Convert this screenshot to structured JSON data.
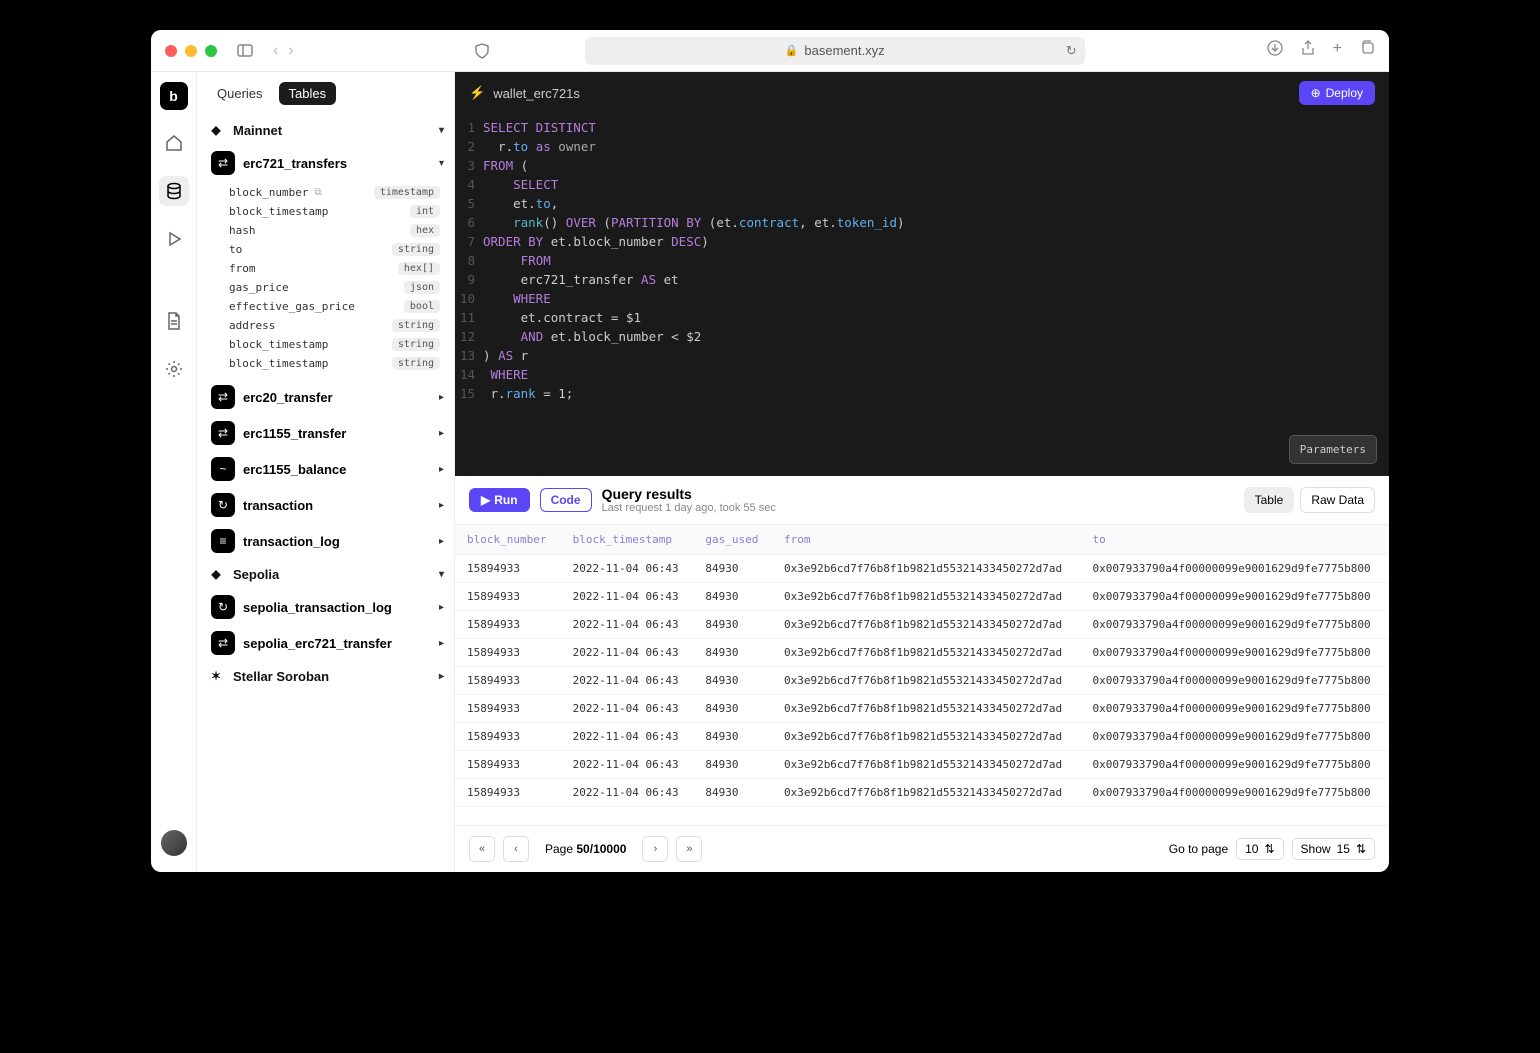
{
  "browser": {
    "url": "basement.xyz"
  },
  "sidebar": {
    "tabs": [
      "Queries",
      "Tables"
    ],
    "active_tab": 1,
    "networks": [
      {
        "name": "Mainnet",
        "icon": "◆",
        "expanded": true,
        "tables": [
          {
            "name": "erc721_transfers",
            "icon": "⇄",
            "expanded": true,
            "columns": [
              {
                "name": "block_number",
                "type": "timestamp"
              },
              {
                "name": "block_timestamp",
                "type": "int"
              },
              {
                "name": "hash",
                "type": "hex"
              },
              {
                "name": "to",
                "type": "string"
              },
              {
                "name": "from",
                "type": "hex[]"
              },
              {
                "name": "gas_price",
                "type": "json"
              },
              {
                "name": "effective_gas_price",
                "type": "bool"
              },
              {
                "name": "address",
                "type": "string"
              },
              {
                "name": "block_timestamp",
                "type": "string"
              },
              {
                "name": "block_timestamp",
                "type": "string"
              }
            ]
          },
          {
            "name": "erc20_transfer",
            "icon": "⇄"
          },
          {
            "name": "erc1155_transfer",
            "icon": "⇄"
          },
          {
            "name": "erc1155_balance",
            "icon": "~"
          },
          {
            "name": "transaction",
            "icon": "↻"
          },
          {
            "name": "transaction_log",
            "icon": "≡"
          }
        ]
      },
      {
        "name": "Sepolia",
        "icon": "◆",
        "expanded": true,
        "tables": [
          {
            "name": "sepolia_transaction_log",
            "icon": "↻"
          },
          {
            "name": "sepolia_erc721_transfer",
            "icon": "⇄"
          }
        ]
      },
      {
        "name": "Stellar Soroban",
        "icon": "✶",
        "expanded": false,
        "tables": []
      }
    ]
  },
  "workspace": {
    "title": "wallet_erc721s",
    "deploy_label": "Deploy",
    "parameters_label": "Parameters",
    "sql_lines": [
      [
        [
          "kw",
          "SELECT DISTINCT"
        ]
      ],
      [
        [
          "op",
          "  r."
        ],
        [
          "id",
          "to"
        ],
        [
          "op",
          " "
        ],
        [
          "kw",
          "as"
        ],
        [
          "op",
          " "
        ],
        [
          "str",
          "owner"
        ]
      ],
      [
        [
          "kw",
          "FROM"
        ],
        [
          "op",
          " ("
        ]
      ],
      [
        [
          "op",
          "    "
        ],
        [
          "kw",
          "SELECT"
        ]
      ],
      [
        [
          "op",
          "    et."
        ],
        [
          "id",
          "to"
        ],
        [
          "op",
          ","
        ]
      ],
      [
        [
          "op",
          "    "
        ],
        [
          "fn",
          "rank"
        ],
        [
          "op",
          "() "
        ],
        [
          "kw",
          "OVER"
        ],
        [
          "op",
          " ("
        ],
        [
          "kw",
          "PARTITION BY"
        ],
        [
          "op",
          " (et."
        ],
        [
          "id",
          "contract"
        ],
        [
          "op",
          ", et."
        ],
        [
          "id",
          "token_id"
        ],
        [
          "op",
          ")"
        ]
      ],
      [
        [
          "kw",
          "ORDER BY"
        ],
        [
          "op",
          " et.block_number "
        ],
        [
          "kw",
          "DESC"
        ],
        [
          "op",
          ")"
        ]
      ],
      [
        [
          "op",
          "     "
        ],
        [
          "kw",
          "FROM"
        ]
      ],
      [
        [
          "op",
          "     erc721_transfer "
        ],
        [
          "kw",
          "AS"
        ],
        [
          "op",
          " et"
        ]
      ],
      [
        [
          "op",
          "    "
        ],
        [
          "kw",
          "WHERE"
        ]
      ],
      [
        [
          "op",
          "     et.contract = $1"
        ]
      ],
      [
        [
          "op",
          "     "
        ],
        [
          "kw",
          "AND"
        ],
        [
          "op",
          " et.block_number < $2"
        ]
      ],
      [
        [
          "op",
          ") "
        ],
        [
          "kw",
          "AS"
        ],
        [
          "op",
          " r"
        ]
      ],
      [
        [
          "op",
          " "
        ],
        [
          "kw",
          "WHERE"
        ]
      ],
      [
        [
          "op",
          " r."
        ],
        [
          "id",
          "rank"
        ],
        [
          "op",
          " = 1;"
        ]
      ]
    ]
  },
  "results": {
    "run_label": "Run",
    "code_label": "Code",
    "title": "Query results",
    "subtitle": "Last request 1 day ago, took 55 sec",
    "view_tabs": [
      "Table",
      "Raw Data"
    ],
    "active_view": 0,
    "columns": [
      "block_number",
      "block_timestamp",
      "gas_used",
      "from",
      "to"
    ],
    "rows": [
      [
        "15894933",
        "2022-11-04 06:43",
        "84930",
        "0x3e92b6cd7f76b8f1b9821d55321433450272d7ad",
        "0x007933790a4f00000099e9001629d9fe7775b800"
      ],
      [
        "15894933",
        "2022-11-04 06:43",
        "84930",
        "0x3e92b6cd7f76b8f1b9821d55321433450272d7ad",
        "0x007933790a4f00000099e9001629d9fe7775b800"
      ],
      [
        "15894933",
        "2022-11-04 06:43",
        "84930",
        "0x3e92b6cd7f76b8f1b9821d55321433450272d7ad",
        "0x007933790a4f00000099e9001629d9fe7775b800"
      ],
      [
        "15894933",
        "2022-11-04 06:43",
        "84930",
        "0x3e92b6cd7f76b8f1b9821d55321433450272d7ad",
        "0x007933790a4f00000099e9001629d9fe7775b800"
      ],
      [
        "15894933",
        "2022-11-04 06:43",
        "84930",
        "0x3e92b6cd7f76b8f1b9821d55321433450272d7ad",
        "0x007933790a4f00000099e9001629d9fe7775b800"
      ],
      [
        "15894933",
        "2022-11-04 06:43",
        "84930",
        "0x3e92b6cd7f76b8f1b9821d55321433450272d7ad",
        "0x007933790a4f00000099e9001629d9fe7775b800"
      ],
      [
        "15894933",
        "2022-11-04 06:43",
        "84930",
        "0x3e92b6cd7f76b8f1b9821d55321433450272d7ad",
        "0x007933790a4f00000099e9001629d9fe7775b800"
      ],
      [
        "15894933",
        "2022-11-04 06:43",
        "84930",
        "0x3e92b6cd7f76b8f1b9821d55321433450272d7ad",
        "0x007933790a4f00000099e9001629d9fe7775b800"
      ],
      [
        "15894933",
        "2022-11-04 06:43",
        "84930",
        "0x3e92b6cd7f76b8f1b9821d55321433450272d7ad",
        "0x007933790a4f00000099e9001629d9fe7775b800"
      ]
    ]
  },
  "pager": {
    "page_label": "Page",
    "current": "50",
    "total": "10000",
    "goto_label": "Go to page",
    "goto_value": "10",
    "show_label": "Show",
    "show_value": "15"
  }
}
